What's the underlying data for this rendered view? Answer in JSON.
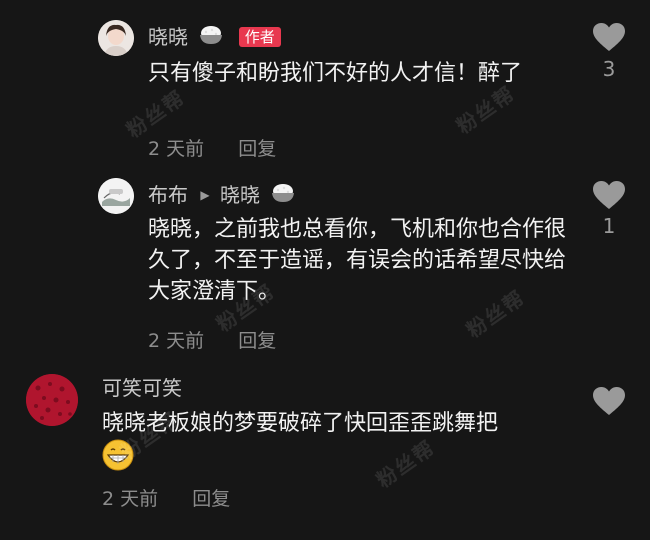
{
  "comments": [
    {
      "user": "晓晓",
      "badge": "作者",
      "text": "只有傻子和盼我们不好的人才信！醉了",
      "time": "2 天前",
      "reply": "回复",
      "likes": "3"
    },
    {
      "user": "布布",
      "reply_to": "晓晓",
      "text": "晓晓，之前我也总看你，飞机和你也合作很久了，不至于造谣，有误会的话希望尽快给大家澄清下。",
      "time": "2 天前",
      "reply": "回复",
      "likes": "1"
    },
    {
      "user": "可笑可笑",
      "text": "晓晓老板娘的梦要破碎了快回歪歪跳舞把",
      "time": "2 天前",
      "reply": "回复",
      "likes": ""
    }
  ],
  "watermark": "粉丝帮",
  "colors": {
    "background": "#161616",
    "badge": "#e8384f",
    "meta": "#8d8d8d"
  }
}
